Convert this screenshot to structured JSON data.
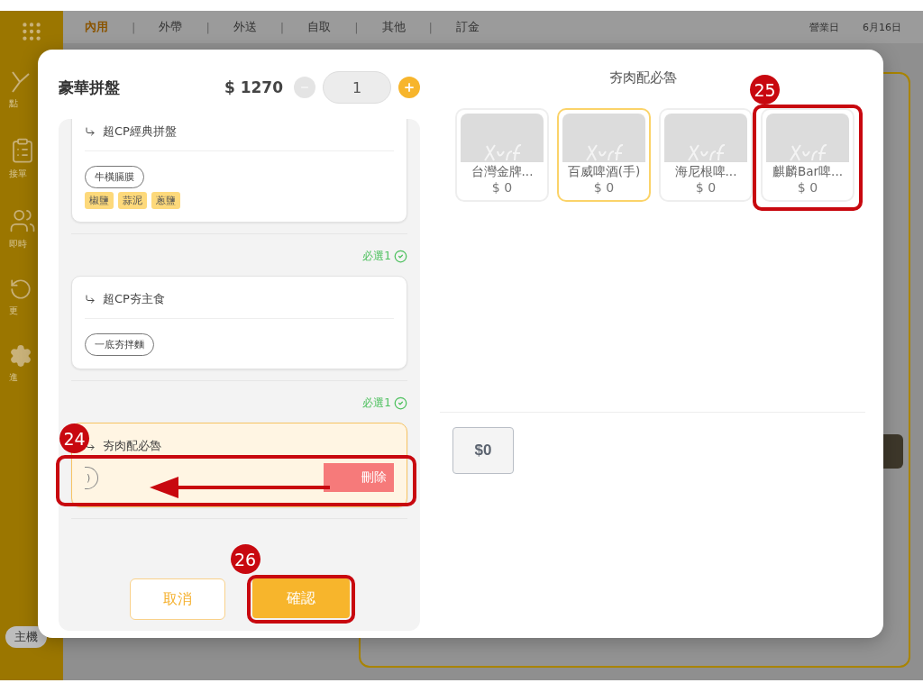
{
  "sidebar": {
    "items": [
      {
        "kind": "logo",
        "label": "點"
      },
      {
        "kind": "clipboard",
        "label": "接單"
      },
      {
        "kind": "group",
        "label": "即時"
      },
      {
        "kind": "refresh",
        "label": "更"
      },
      {
        "kind": "gear",
        "label": "進"
      }
    ],
    "host": "主機"
  },
  "top_bar": {
    "tabs": [
      {
        "label": "內用",
        "selected": true
      },
      {
        "label": "外帶",
        "selected": false
      },
      {
        "label": "外送",
        "selected": false
      },
      {
        "label": "自取",
        "selected": false
      },
      {
        "label": "其他",
        "selected": false
      },
      {
        "label": "訂金",
        "selected": false
      }
    ],
    "separator": "|",
    "business_day": "營業日",
    "date": "6月16日"
  },
  "modal": {
    "title": "豪華拼盤",
    "price": "$ 1270",
    "quantity": "1",
    "sections": [
      {
        "kind": "card",
        "title": "超CP經典拼盤",
        "highlighted": false,
        "chips": [
          "牛橫膈膜"
        ],
        "tags": [
          "椒鹽",
          "蒜泥",
          "蔥鹽"
        ]
      },
      {
        "kind": "requirement",
        "label": "必選1"
      },
      {
        "kind": "card",
        "title": "超CP夯主食",
        "highlighted": false,
        "chips": [
          "一底夯拌麵"
        ]
      },
      {
        "kind": "requirement",
        "label": "必選1"
      },
      {
        "kind": "card",
        "title": "夯肉配必魯",
        "highlighted": true,
        "swipe": {
          "chip": ")",
          "action": "刪除",
          "annotation": {
            "number": "24",
            "arrow": true
          }
        }
      }
    ],
    "cancel": "取消",
    "confirm": {
      "label": "確認",
      "annotation": {
        "number": "26",
        "arrow": false
      }
    },
    "option_title": "夯肉配必魯",
    "products": [
      {
        "name": "台灣金牌...",
        "price": "$ 0",
        "selected": false
      },
      {
        "name": "百威啤酒(手)",
        "price": "$ 0",
        "selected": true
      },
      {
        "name": "海尼根啤...",
        "price": "$ 0",
        "selected": false
      },
      {
        "name": "麒麟Bar啤...",
        "price": "$ 0",
        "selected": false,
        "annotation": {
          "number": "25",
          "arrow": false
        }
      }
    ],
    "price_button": "$0"
  }
}
